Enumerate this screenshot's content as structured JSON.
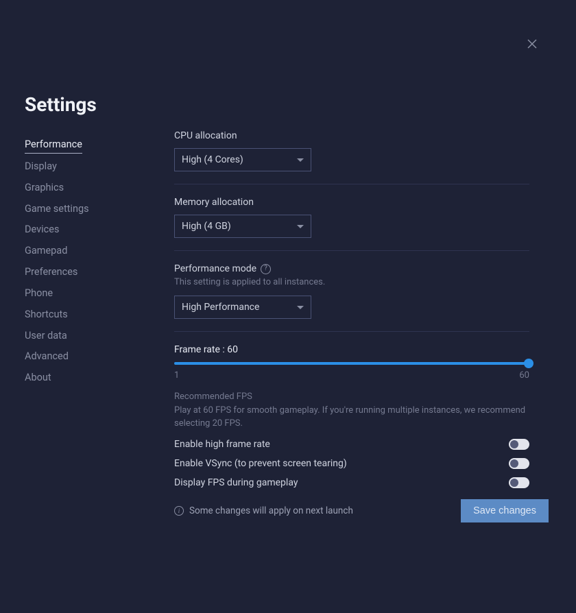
{
  "title": "Settings",
  "sidebar": {
    "items": [
      {
        "label": "Performance",
        "active": true
      },
      {
        "label": "Display"
      },
      {
        "label": "Graphics"
      },
      {
        "label": "Game settings"
      },
      {
        "label": "Devices"
      },
      {
        "label": "Gamepad"
      },
      {
        "label": "Preferences"
      },
      {
        "label": "Phone"
      },
      {
        "label": "Shortcuts"
      },
      {
        "label": "User data"
      },
      {
        "label": "Advanced"
      },
      {
        "label": "About"
      }
    ]
  },
  "cpu": {
    "label": "CPU allocation",
    "value": "High (4 Cores)"
  },
  "memory": {
    "label": "Memory allocation",
    "value": "High (4 GB)"
  },
  "perfmode": {
    "label": "Performance mode",
    "note": "This setting is applied to all instances.",
    "value": "High Performance"
  },
  "framerate": {
    "label_full": "Frame rate : 60",
    "min": "1",
    "max": "60",
    "rec_title": "Recommended FPS",
    "rec_body": "Play at 60 FPS for smooth gameplay. If you're running multiple instances, we recommend selecting 20 FPS."
  },
  "toggles": {
    "high_fr": "Enable high frame rate",
    "vsync": "Enable VSync (to prevent screen tearing)",
    "display_fps": "Display FPS during gameplay"
  },
  "footer": {
    "note": "Some changes will apply on next launch",
    "save": "Save changes"
  }
}
